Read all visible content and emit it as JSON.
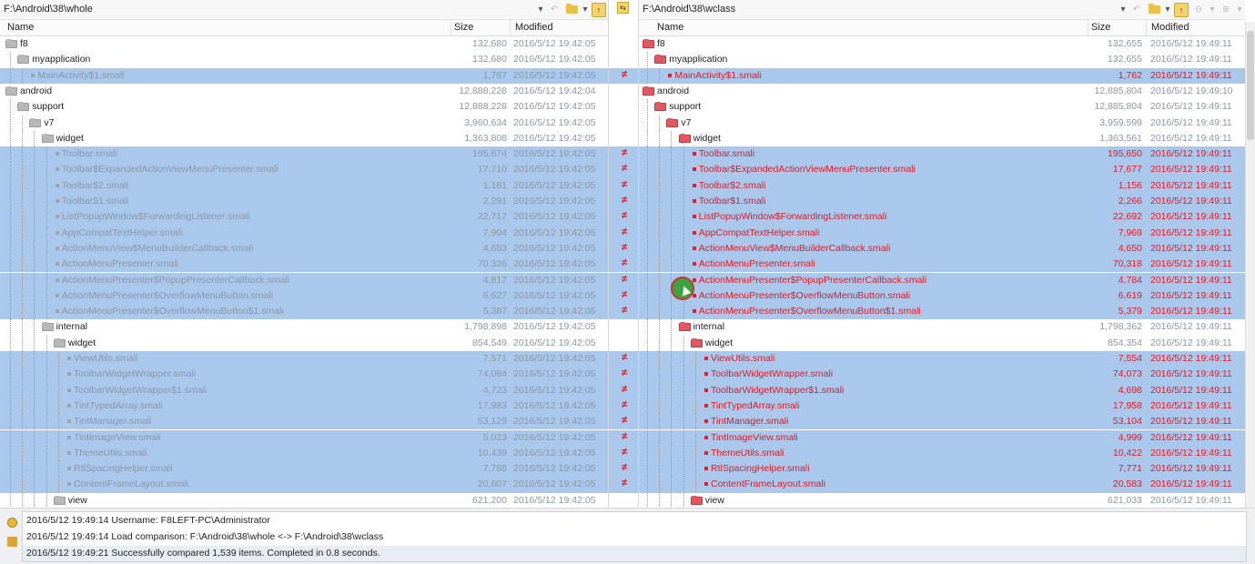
{
  "left": {
    "path": "F:\\Android\\38\\whole",
    "columns": {
      "name": "Name",
      "size": "Size",
      "modified": "Modified"
    },
    "rows": [
      {
        "name": "f8",
        "size": "132,680",
        "date": "2016/5/12 19:42:05",
        "kind": "folder",
        "depth": 0,
        "sel": false
      },
      {
        "name": "myapplication",
        "size": "132,680",
        "date": "2016/5/12 19:42:05",
        "kind": "folder",
        "depth": 1,
        "sel": false
      },
      {
        "name": "MainActivity$1.smali",
        "size": "1,787",
        "date": "2016/5/12 19:42:05",
        "kind": "file",
        "depth": 2,
        "sel": true
      },
      {
        "name": "android",
        "size": "12,888,228",
        "date": "2016/5/12 19:42:04",
        "kind": "folder",
        "depth": 0,
        "sel": false
      },
      {
        "name": "support",
        "size": "12,888,228",
        "date": "2016/5/12 19:42:05",
        "kind": "folder",
        "depth": 1,
        "sel": false
      },
      {
        "name": "v7",
        "size": "3,960,634",
        "date": "2016/5/12 19:42:05",
        "kind": "folder",
        "depth": 2,
        "sel": false
      },
      {
        "name": "widget",
        "size": "1,363,808",
        "date": "2016/5/12 19:42:05",
        "kind": "folder",
        "depth": 3,
        "sel": false
      },
      {
        "name": "Toolbar.smali",
        "size": "195,674",
        "date": "2016/5/12 19:42:05",
        "kind": "file",
        "depth": 4,
        "sel": true
      },
      {
        "name": "Toolbar$ExpandedActionViewMenuPresenter.smali",
        "size": "17,710",
        "date": "2016/5/12 19:42:05",
        "kind": "file",
        "depth": 4,
        "sel": true
      },
      {
        "name": "Toolbar$2.smali",
        "size": "1,181",
        "date": "2016/5/12 19:42:05",
        "kind": "file",
        "depth": 4,
        "sel": true
      },
      {
        "name": "Toolbar$1.smali",
        "size": "2,291",
        "date": "2016/5/12 19:42:05",
        "kind": "file",
        "depth": 4,
        "sel": true
      },
      {
        "name": "ListPopupWindow$ForwardingListener.smali",
        "size": "22,717",
        "date": "2016/5/12 19:42:05",
        "kind": "file",
        "depth": 4,
        "sel": true
      },
      {
        "name": "AppCompatTextHelper.smali",
        "size": "7,994",
        "date": "2016/5/12 19:42:05",
        "kind": "file",
        "depth": 4,
        "sel": true
      },
      {
        "name": "ActionMenuView$MenuBuilderCallback.smali",
        "size": "4,683",
        "date": "2016/5/12 19:42:05",
        "kind": "file",
        "depth": 4,
        "sel": true
      },
      {
        "name": "ActionMenuPresenter.smali",
        "size": "70,326",
        "date": "2016/5/12 19:42:05",
        "kind": "file",
        "depth": 4,
        "sel": true
      },
      {
        "name": "ActionMenuPresenter$PopupPresenterCallback.smali",
        "size": "4,817",
        "date": "2016/5/12 19:42:05",
        "kind": "file",
        "depth": 4,
        "sel": true
      },
      {
        "name": "ActionMenuPresenter$OverflowMenuButton.smali",
        "size": "6,627",
        "date": "2016/5/12 19:42:05",
        "kind": "file",
        "depth": 4,
        "sel": true
      },
      {
        "name": "ActionMenuPresenter$OverflowMenuButton$1.smali",
        "size": "5,387",
        "date": "2016/5/12 19:42:05",
        "kind": "file",
        "depth": 4,
        "sel": true
      },
      {
        "name": "internal",
        "size": "1,798,898",
        "date": "2016/5/12 19:42:05",
        "kind": "folder",
        "depth": 3,
        "sel": false
      },
      {
        "name": "widget",
        "size": "854,549",
        "date": "2016/5/12 19:42:05",
        "kind": "folder",
        "depth": 4,
        "sel": false
      },
      {
        "name": "ViewUtils.smali",
        "size": "7,571",
        "date": "2016/5/12 19:42:05",
        "kind": "file",
        "depth": 5,
        "sel": true
      },
      {
        "name": "ToolbarWidgetWrapper.smali",
        "size": "74,094",
        "date": "2016/5/12 19:42:05",
        "kind": "file",
        "depth": 5,
        "sel": true
      },
      {
        "name": "ToolbarWidgetWrapper$1.smali",
        "size": "4,723",
        "date": "2016/5/12 19:42:05",
        "kind": "file",
        "depth": 5,
        "sel": true
      },
      {
        "name": "TintTypedArray.smali",
        "size": "17,983",
        "date": "2016/5/12 19:42:05",
        "kind": "file",
        "depth": 5,
        "sel": true
      },
      {
        "name": "TintManager.smali",
        "size": "53,129",
        "date": "2016/5/12 19:42:05",
        "kind": "file",
        "depth": 5,
        "sel": true
      },
      {
        "name": "TintImageView.smali",
        "size": "5,023",
        "date": "2016/5/12 19:42:05",
        "kind": "file",
        "depth": 5,
        "sel": true
      },
      {
        "name": "ThemeUtils.smali",
        "size": "10,439",
        "date": "2016/5/12 19:42:05",
        "kind": "file",
        "depth": 5,
        "sel": true
      },
      {
        "name": "RtlSpacingHelper.smali",
        "size": "7,788",
        "date": "2016/5/12 19:42:05",
        "kind": "file",
        "depth": 5,
        "sel": true
      },
      {
        "name": "ContentFrameLayout.smali",
        "size": "20,607",
        "date": "2016/5/12 19:42:05",
        "kind": "file",
        "depth": 5,
        "sel": true
      },
      {
        "name": "view",
        "size": "621,200",
        "date": "2016/5/12 19:42:05",
        "kind": "folder",
        "depth": 4,
        "sel": false
      }
    ]
  },
  "right": {
    "path": "F:\\Android\\38\\wclass",
    "columns": {
      "name": "Name",
      "size": "Size",
      "modified": "Modified"
    },
    "rows": [
      {
        "name": "f8",
        "size": "132,655",
        "date": "2016/5/12 19:49:11"
      },
      {
        "name": "myapplication",
        "size": "132,655",
        "date": "2016/5/12 19:49:11"
      },
      {
        "name": "MainActivity$1.smali",
        "size": "1,762",
        "date": "2016/5/12 19:49:11"
      },
      {
        "name": "android",
        "size": "12,885,804",
        "date": "2016/5/12 19:49:10"
      },
      {
        "name": "support",
        "size": "12,885,804",
        "date": "2016/5/12 19:49:11"
      },
      {
        "name": "v7",
        "size": "3,959,599",
        "date": "2016/5/12 19:49:11"
      },
      {
        "name": "widget",
        "size": "1,363,561",
        "date": "2016/5/12 19:49:11"
      },
      {
        "name": "Toolbar.smali",
        "size": "195,650",
        "date": "2016/5/12 19:49:11"
      },
      {
        "name": "Toolbar$ExpandedActionViewMenuPresenter.smali",
        "size": "17,677",
        "date": "2016/5/12 19:49:11"
      },
      {
        "name": "Toolbar$2.smali",
        "size": "1,156",
        "date": "2016/5/12 19:49:11"
      },
      {
        "name": "Toolbar$1.smali",
        "size": "2,266",
        "date": "2016/5/12 19:49:11"
      },
      {
        "name": "ListPopupWindow$ForwardingListener.smali",
        "size": "22,692",
        "date": "2016/5/12 19:49:11"
      },
      {
        "name": "AppCompatTextHelper.smali",
        "size": "7,969",
        "date": "2016/5/12 19:49:11"
      },
      {
        "name": "ActionMenuView$MenuBuilderCallback.smali",
        "size": "4,650",
        "date": "2016/5/12 19:49:11"
      },
      {
        "name": "ActionMenuPresenter.smali",
        "size": "70,318",
        "date": "2016/5/12 19:49:11"
      },
      {
        "name": "ActionMenuPresenter$PopupPresenterCallback.smali",
        "size": "4,784",
        "date": "2016/5/12 19:49:11"
      },
      {
        "name": "ActionMenuPresenter$OverflowMenuButton.smali",
        "size": "6,619",
        "date": "2016/5/12 19:49:11"
      },
      {
        "name": "ActionMenuPresenter$OverflowMenuButton$1.smali",
        "size": "5,379",
        "date": "2016/5/12 19:49:11"
      },
      {
        "name": "internal",
        "size": "1,798,362",
        "date": "2016/5/12 19:49:11"
      },
      {
        "name": "widget",
        "size": "854,354",
        "date": "2016/5/12 19:49:11"
      },
      {
        "name": "ViewUtils.smali",
        "size": "7,554",
        "date": "2016/5/12 19:49:11"
      },
      {
        "name": "ToolbarWidgetWrapper.smali",
        "size": "74,073",
        "date": "2016/5/12 19:49:11"
      },
      {
        "name": "ToolbarWidgetWrapper$1.smali",
        "size": "4,698",
        "date": "2016/5/12 19:49:11"
      },
      {
        "name": "TintTypedArray.smali",
        "size": "17,958",
        "date": "2016/5/12 19:49:11"
      },
      {
        "name": "TintManager.smali",
        "size": "53,104",
        "date": "2016/5/12 19:49:11"
      },
      {
        "name": "TintImageView.smali",
        "size": "4,999",
        "date": "2016/5/12 19:49:11"
      },
      {
        "name": "ThemeUtils.smali",
        "size": "10,422",
        "date": "2016/5/12 19:49:11"
      },
      {
        "name": "RtlSpacingHelper.smali",
        "size": "7,771",
        "date": "2016/5/12 19:49:11"
      },
      {
        "name": "ContentFrameLayout.smali",
        "size": "20,583",
        "date": "2016/5/12 19:49:11"
      },
      {
        "name": "view",
        "size": "621,033",
        "date": "2016/5/12 19:49:11"
      }
    ]
  },
  "gutter": {
    "diff_mark": "≠"
  },
  "log": [
    "2016/5/12 19:49:14  Username: F8LEFT-PC\\Administrator",
    "2016/5/12 19:49:14  Load comparison: F:\\Android\\38\\whole <-> F:\\Android\\38\\wclass",
    "2016/5/12 19:49:21  Successfully compared 1,539 items.  Completed in 0.8 seconds."
  ],
  "icons": {
    "folder": "folder-icon",
    "file": "file-bullet-icon",
    "diff": "not-equal-icon"
  },
  "colors": {
    "selection": "#a9c8ec",
    "diff_red": "#e01a25",
    "same_gray": "#8a96a6",
    "folder_yellow": "#e8c04a"
  }
}
